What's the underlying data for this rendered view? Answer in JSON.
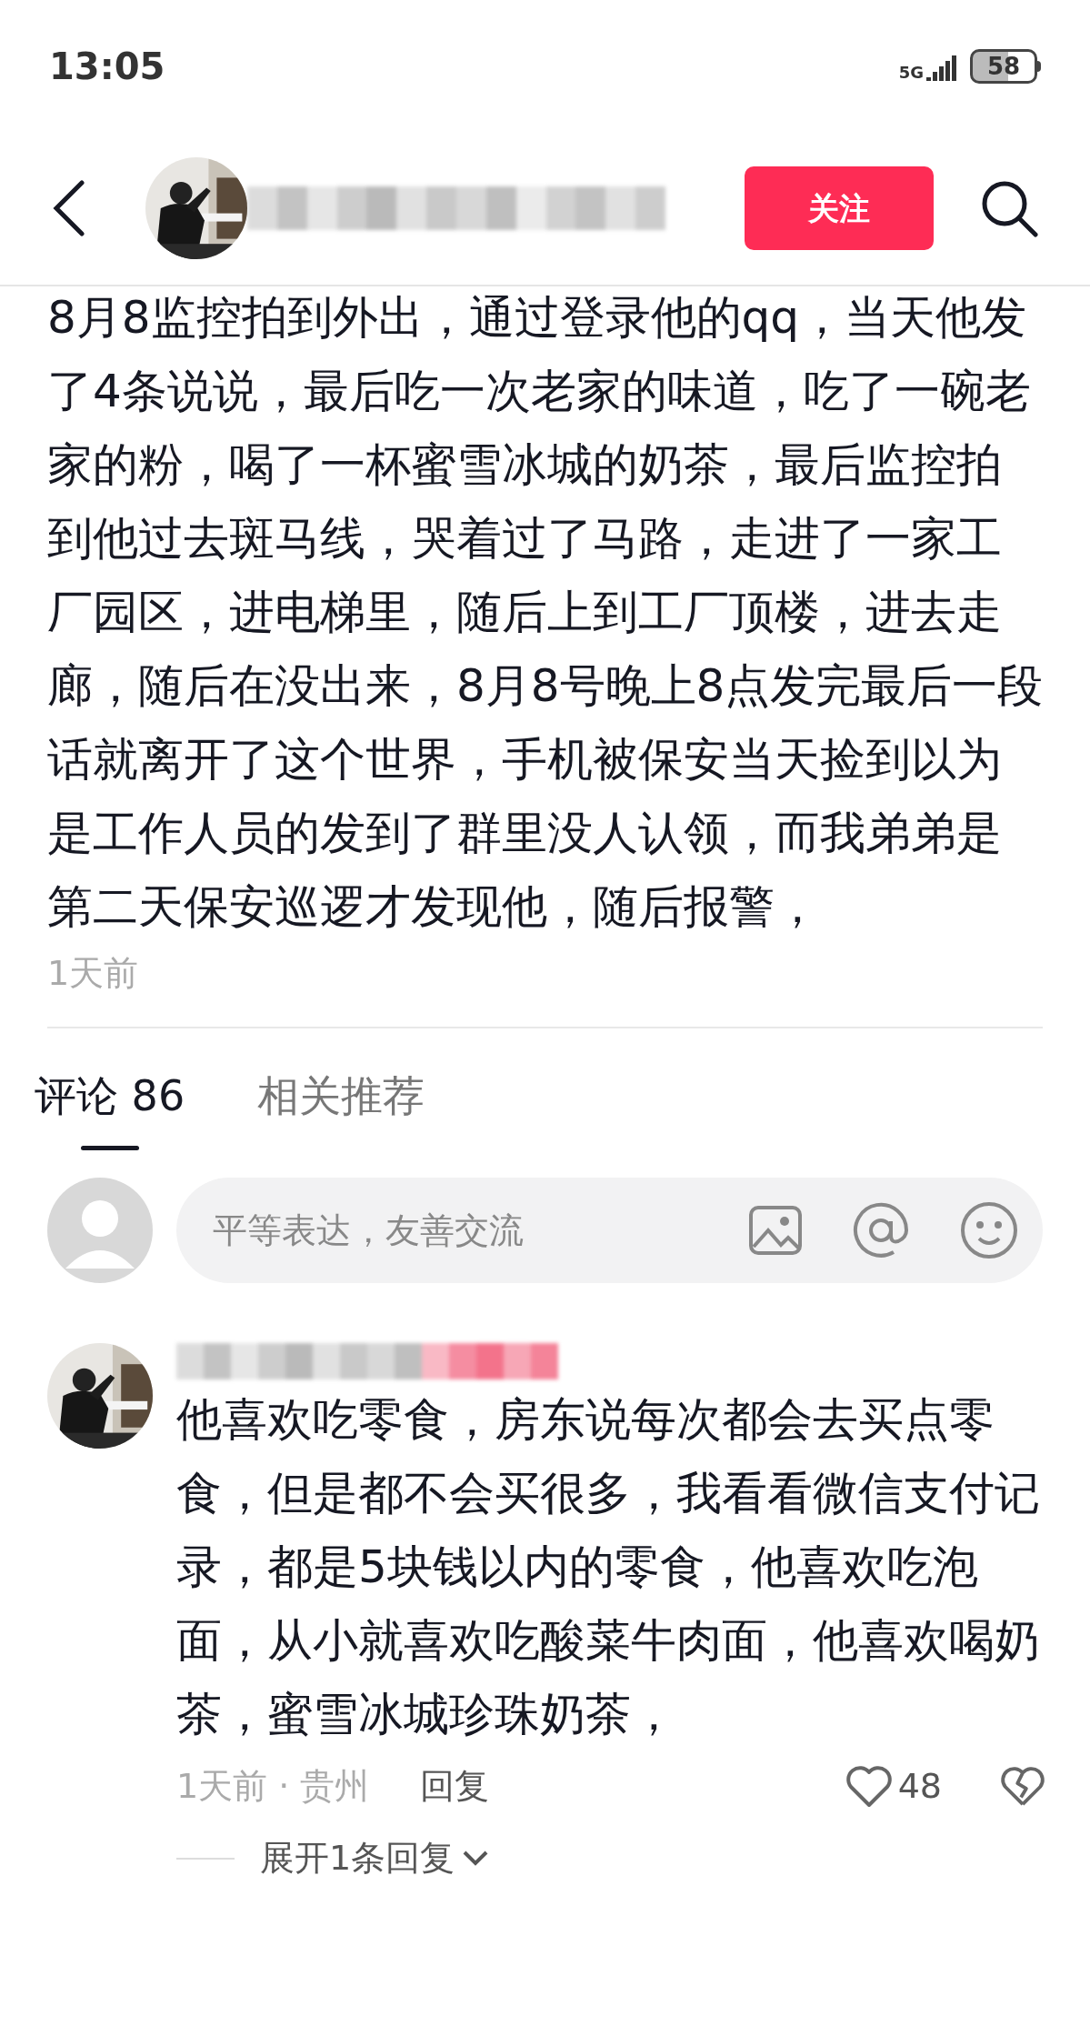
{
  "status_bar": {
    "time": "13:05",
    "network": "5G",
    "battery": "58"
  },
  "header": {
    "follow_button": "关注"
  },
  "post": {
    "text": "8月8监控拍到外出，通过登录他的qq，当天他发了4条说说，最后吃一次老家的味道，吃了一碗老家的粉，喝了一杯蜜雪冰城的奶茶，最后监控拍到他过去斑马线，哭着过了马路，走进了一家工厂园区，进电梯里，随后上到工厂顶楼，进去走廊，随后在没出来，8月8号晚上8点发完最后一段话就离开了这个世界，手机被保安当天捡到以为是工作人员的发到了群里没人认领，而我弟弟是第二天保安巡逻才发现他，随后报警，",
    "time": "1天前"
  },
  "tabs": [
    {
      "label": "评论",
      "count": "86",
      "selected": true
    },
    {
      "label": "相关推荐",
      "selected": false
    }
  ],
  "comment_input": {
    "placeholder": "平等表达，友善交流"
  },
  "comments": [
    {
      "text": "他喜欢吃零食，房东说每次都会去买点零食，但是都不会买很多，我看看微信支付记录，都是5块钱以内的零食，他喜欢吃泡面，从小就喜欢吃酸菜牛肉面，他喜欢喝奶茶，蜜雪冰城珍珠奶茶，",
      "meta": "1天前 · 贵州",
      "reply": "回复",
      "likes": "48",
      "liked": false,
      "expand": "展开1条回复"
    }
  ]
}
